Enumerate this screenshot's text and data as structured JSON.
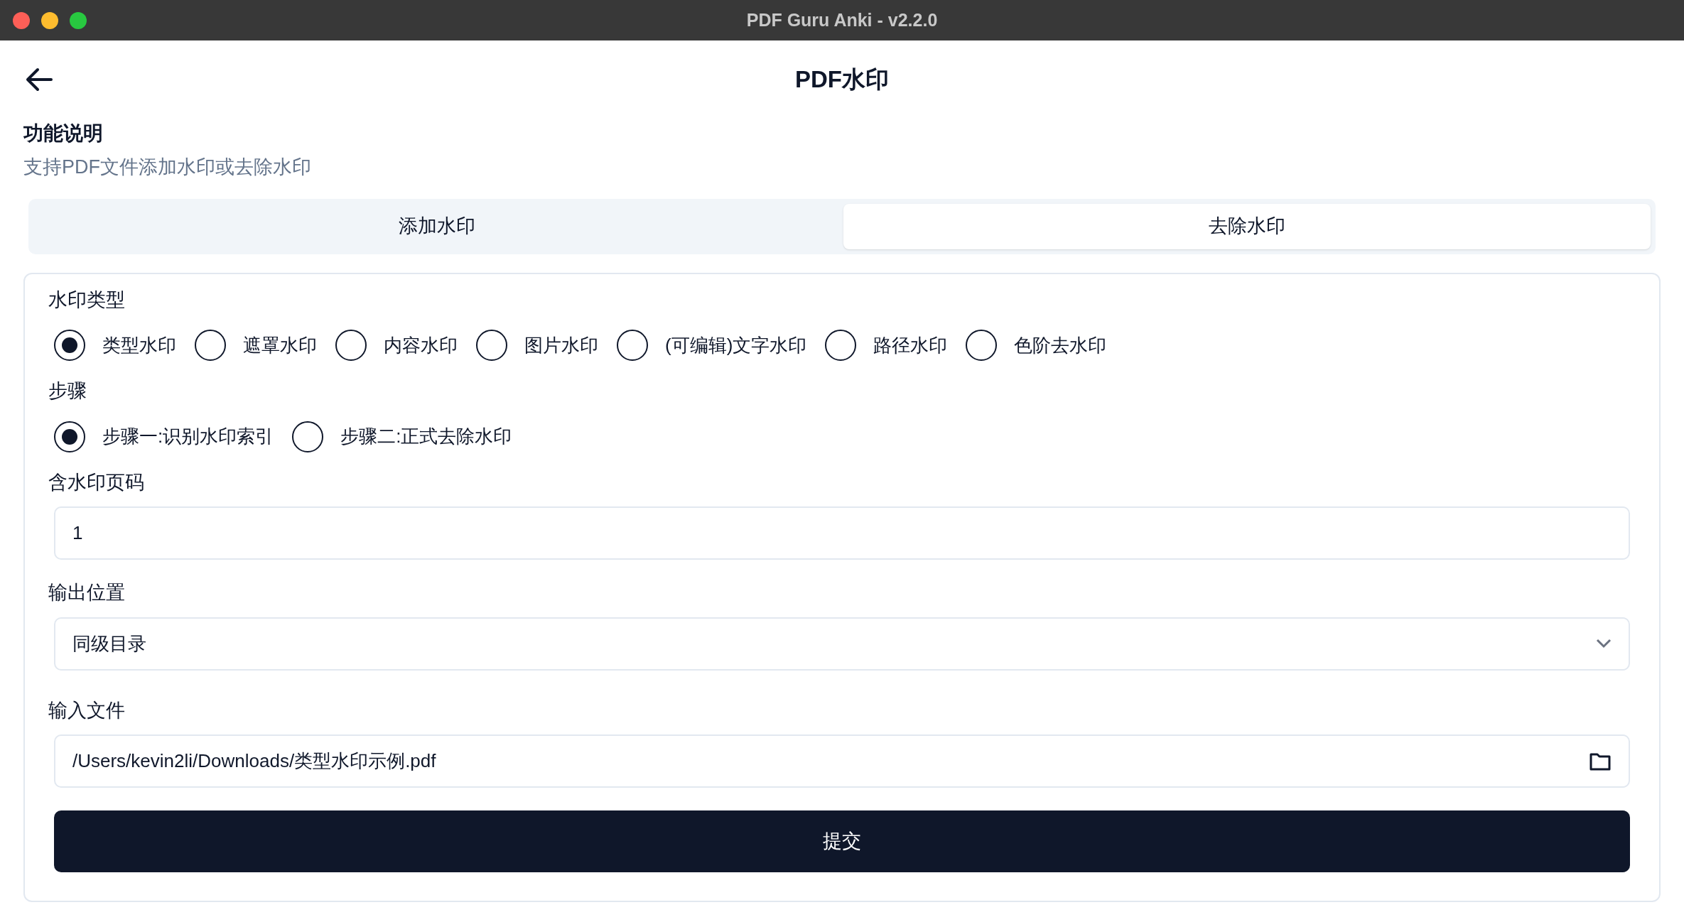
{
  "window": {
    "title": "PDF Guru Anki - v2.2.0"
  },
  "header": {
    "title": "PDF水印"
  },
  "description": {
    "heading": "功能说明",
    "text": "支持PDF文件添加水印或去除水印"
  },
  "tabs": [
    {
      "label": "添加水印",
      "selected": false
    },
    {
      "label": "去除水印",
      "selected": true
    }
  ],
  "fields": [
    {
      "kind": "radio",
      "label": "水印类型",
      "options": [
        {
          "label": "类型水印",
          "selected": true
        },
        {
          "label": "遮罩水印",
          "selected": false
        },
        {
          "label": "内容水印",
          "selected": false
        },
        {
          "label": "图片水印",
          "selected": false
        },
        {
          "label": "(可编辑)文字水印",
          "selected": false
        },
        {
          "label": "路径水印",
          "selected": false
        },
        {
          "label": "色阶去水印",
          "selected": false
        }
      ]
    },
    {
      "kind": "radio",
      "label": "步骤",
      "options": [
        {
          "label": "步骤一:识别水印索引",
          "selected": true
        },
        {
          "label": "步骤二:正式去除水印",
          "selected": false
        }
      ]
    },
    {
      "kind": "text",
      "label": "含水印页码",
      "value": "1"
    },
    {
      "kind": "select",
      "label": "输出位置",
      "value": "同级目录"
    },
    {
      "kind": "file",
      "label": "输入文件",
      "value": "/Users/kevin2li/Downloads/类型水印示例.pdf"
    }
  ],
  "submit": {
    "label": "提交"
  }
}
